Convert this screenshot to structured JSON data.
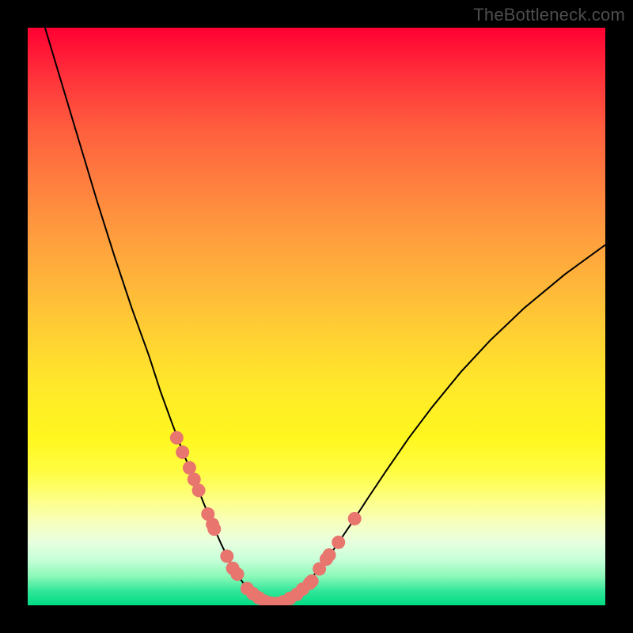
{
  "watermark": "TheBottleneck.com",
  "chart_data": {
    "type": "line",
    "title": "",
    "xlabel": "",
    "ylabel": "",
    "xlim": [
      0,
      100
    ],
    "ylim": [
      0,
      100
    ],
    "curve": {
      "x": [
        3,
        6,
        9,
        12,
        15,
        18,
        21,
        23,
        25,
        27,
        29,
        30.5,
        32,
        33.5,
        35,
        36.5,
        38,
        40,
        42,
        44,
        46,
        48,
        50,
        53,
        56,
        59,
        62,
        66,
        70,
        75,
        80,
        86,
        93,
        100
      ],
      "y": [
        100,
        90,
        80,
        70,
        60.5,
        51.5,
        43.2,
        37,
        31.5,
        26.2,
        21.4,
        17.6,
        14.0,
        10.6,
        7.5,
        5.0,
        2.9,
        1.3,
        0.4,
        0.5,
        1.5,
        3.3,
        5.8,
        9.7,
        14.1,
        18.7,
        23.2,
        29.0,
        34.3,
        40.4,
        45.8,
        51.5,
        57.3,
        62.4
      ]
    },
    "markers": {
      "x": [
        25.8,
        26.8,
        28.0,
        28.8,
        29.6,
        31.2,
        32.0,
        32.3,
        34.5,
        35.5,
        36.3,
        38.0,
        39.0,
        40.0,
        41.0,
        42.0,
        43.0,
        44.2,
        45.4,
        46.6,
        47.6,
        48.8,
        49.2,
        50.5,
        51.7,
        52.2,
        53.8,
        56.6
      ],
      "y": [
        29.0,
        26.5,
        23.8,
        21.8,
        19.9,
        15.8,
        14.0,
        13.2,
        8.5,
        6.4,
        5.4,
        2.9,
        2.0,
        1.3,
        0.7,
        0.4,
        0.3,
        0.6,
        1.2,
        1.9,
        2.8,
        3.8,
        4.2,
        6.3,
        8.0,
        8.7,
        10.9,
        15.0
      ]
    },
    "background_gradient": {
      "top": "#ff0033",
      "middle": "#ffe82a",
      "bottom": "#00db83"
    },
    "marker_color": "#e8756e",
    "curve_color": "#000000"
  }
}
